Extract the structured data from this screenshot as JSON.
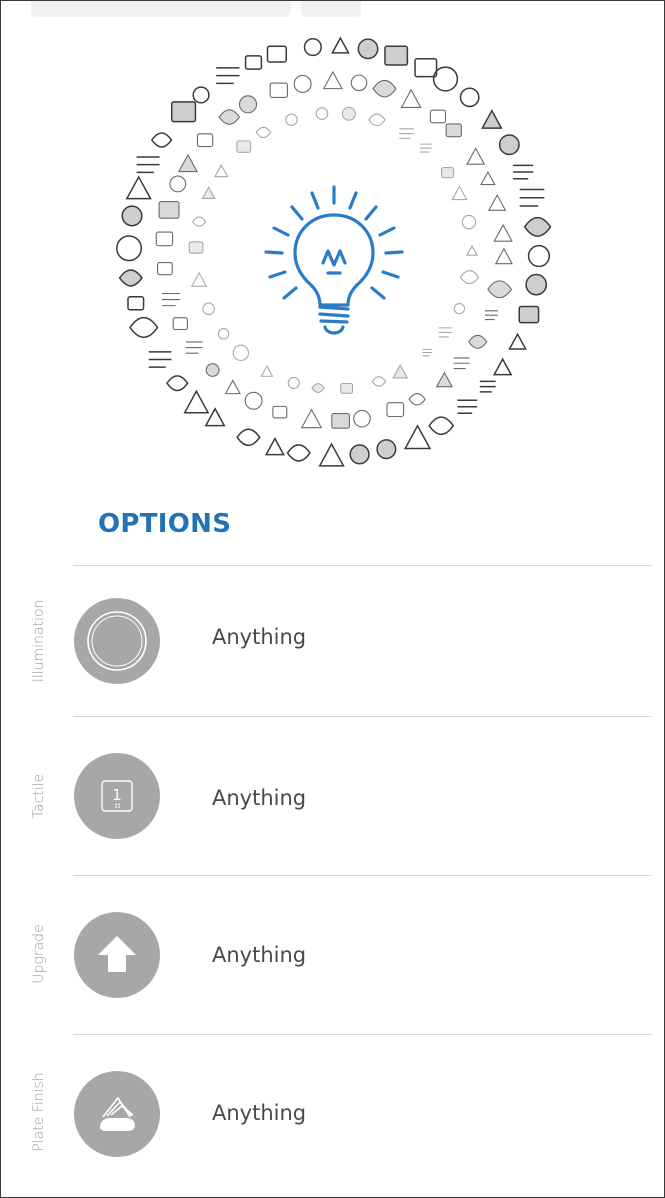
{
  "section_title": "OPTIONS",
  "colors": {
    "accent": "#2272b6",
    "icon_circle": "#a7a7a9",
    "divider": "#d9d9d9",
    "label_gray": "#9a9a9a"
  },
  "hero": {
    "icon": "lightbulb-icon",
    "tactile_digit": "1"
  },
  "options": [
    {
      "label": "Illumination",
      "icon": "ring-icon",
      "value": "Anything"
    },
    {
      "label": "Tactile",
      "icon": "braille-key-icon",
      "value": "Anything"
    },
    {
      "label": "Upgrade",
      "icon": "arrow-up-icon",
      "value": "Anything"
    },
    {
      "label": "Plate Finish",
      "icon": "layers-icon",
      "value": "Anything"
    }
  ]
}
